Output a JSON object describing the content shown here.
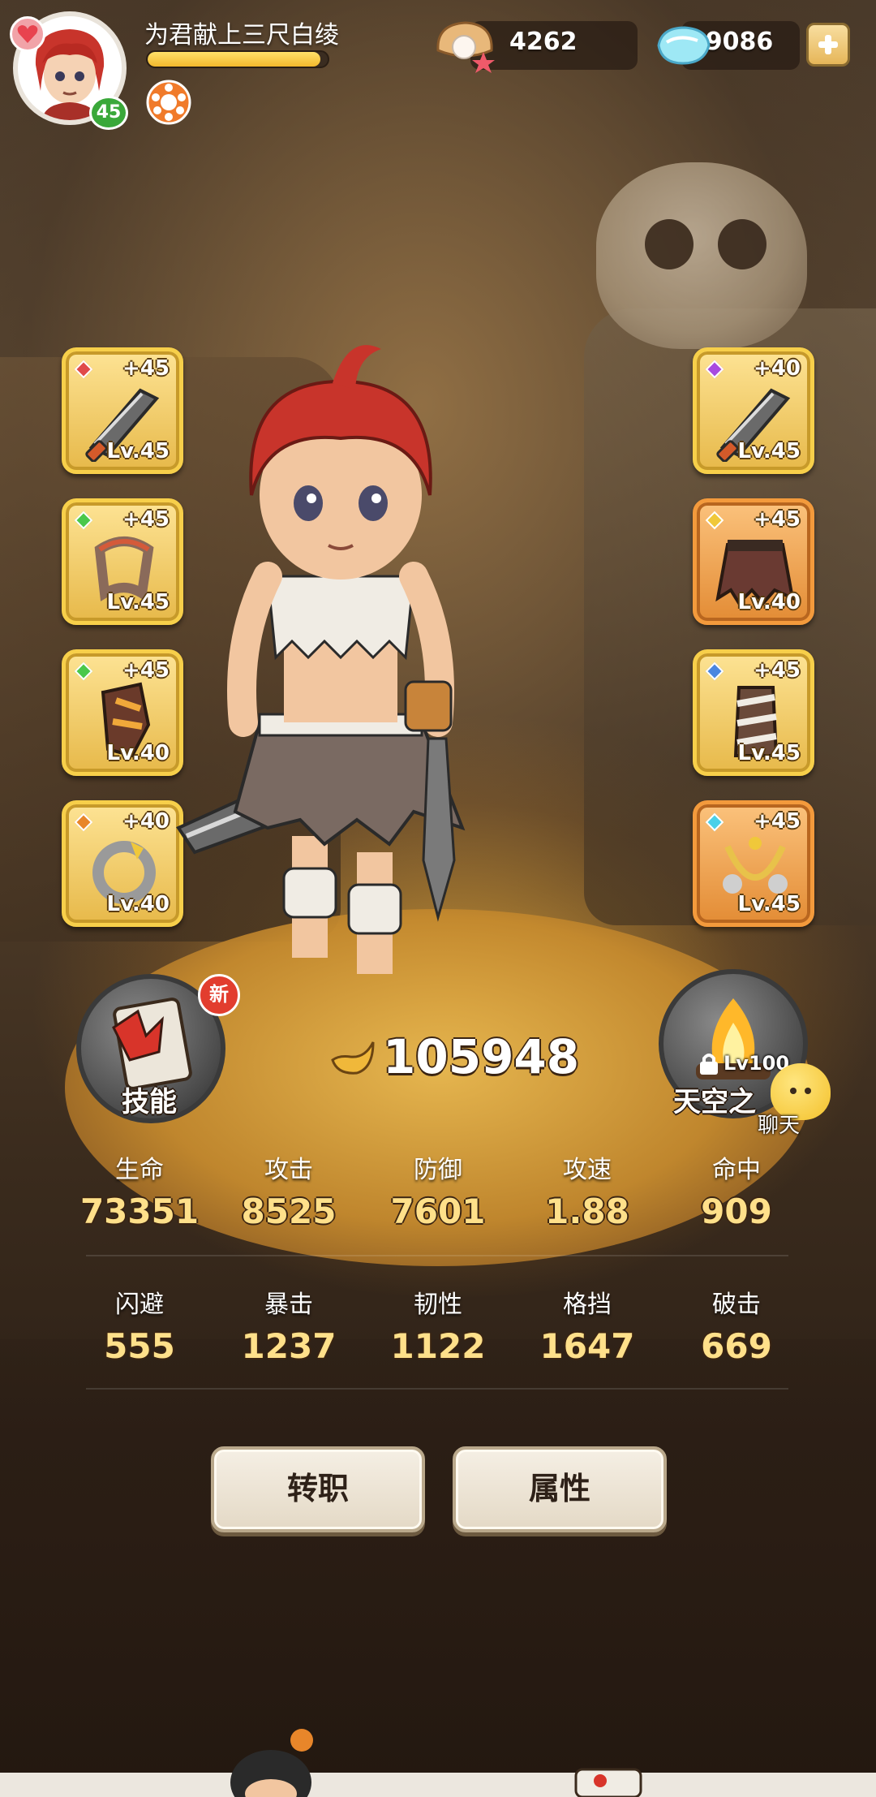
{
  "player": {
    "name": "为君献上三尺白绫",
    "level": "45",
    "xp_progress": 0.96
  },
  "currencies": {
    "shells": "4262",
    "gems": "119086"
  },
  "equipment_left": [
    {
      "plus": "+45",
      "level": "Lv.45",
      "gem": "#e04a4a",
      "item": "sword-icon",
      "frame": "gold"
    },
    {
      "plus": "+45",
      "level": "Lv.45",
      "gem": "#4ac84a",
      "item": "bracer-icon",
      "frame": "gold"
    },
    {
      "plus": "+45",
      "level": "Lv.40",
      "gem": "#4ac84a",
      "item": "glove-icon",
      "frame": "gold"
    },
    {
      "plus": "+40",
      "level": "Lv.40",
      "gem": "#e8862a",
      "item": "ring-icon",
      "frame": "gold"
    }
  ],
  "equipment_right": [
    {
      "plus": "+40",
      "level": "Lv.45",
      "gem": "#a84ae0",
      "item": "sword-icon",
      "frame": "gold"
    },
    {
      "plus": "+45",
      "level": "Lv.40",
      "gem": "#f0c83a",
      "item": "skirt-icon",
      "frame": "orange"
    },
    {
      "plus": "+45",
      "level": "Lv.45",
      "gem": "#4a86e0",
      "item": "leg-wrap-icon",
      "frame": "gold"
    },
    {
      "plus": "+45",
      "level": "Lv.45",
      "gem": "#4ad0e8",
      "item": "necklace-icon",
      "frame": "orange"
    }
  ],
  "skill": {
    "label": "技能",
    "badge": "新"
  },
  "tower": {
    "label": "天空之",
    "lock": "Lv100"
  },
  "chat": {
    "label": "聊天"
  },
  "combat_power": "105948",
  "stats_row1": [
    {
      "label": "生命",
      "value": "73351"
    },
    {
      "label": "攻击",
      "value": "8525"
    },
    {
      "label": "防御",
      "value": "7601"
    },
    {
      "label": "攻速",
      "value": "1.88"
    },
    {
      "label": "命中",
      "value": "909"
    }
  ],
  "stats_row2": [
    {
      "label": "闪避",
      "value": "555"
    },
    {
      "label": "暴击",
      "value": "1237"
    },
    {
      "label": "韧性",
      "value": "1122"
    },
    {
      "label": "格挡",
      "value": "1647"
    },
    {
      "label": "破击",
      "value": "669"
    }
  ],
  "buttons": {
    "change_class": "转职",
    "attributes": "属性"
  },
  "colors": {
    "gold_frame": "#f7cf4a",
    "orange_frame": "#f39a3c",
    "stat_value": "#ffe08a",
    "level_badge": "#3aa83a"
  }
}
